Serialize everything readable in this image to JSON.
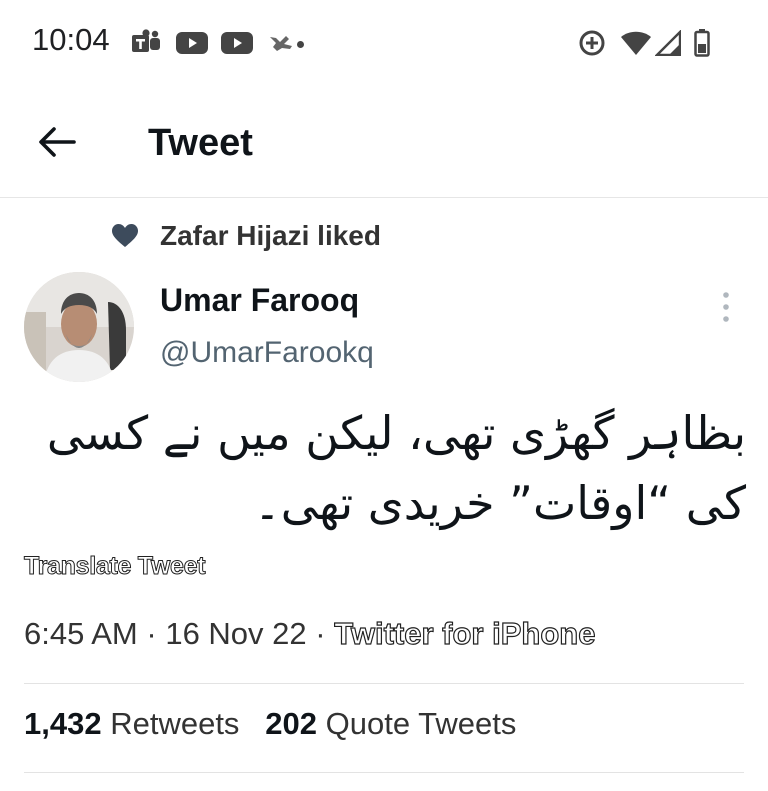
{
  "status_bar": {
    "time": "10:04",
    "icons": [
      "teams-icon",
      "youtube-icon",
      "youtube-icon",
      "notification-icon",
      "dot-icon",
      "sync-icon",
      "wifi-icon",
      "signal-icon",
      "battery-icon"
    ]
  },
  "header": {
    "back_icon": "arrow-left-icon",
    "title": "Tweet"
  },
  "social_context": {
    "icon": "heart-icon",
    "text": "Zafar Hijazi liked"
  },
  "author": {
    "name": "Umar Farooq",
    "handle": "@UmarFarookq"
  },
  "tweet": {
    "text": "بظاہر گھڑی تھی، لیکن میں نے کسی کی “اوقات” خریدی تھی۔",
    "translate_label": "Translate Tweet",
    "time": "6:45 AM",
    "separator": "·",
    "date": "16 Nov 22",
    "source": "Twitter for iPhone"
  },
  "stats": {
    "retweets_count": "1,432",
    "retweets_label": "Retweets",
    "quotes_count": "202",
    "quotes_label": "Quote Tweets"
  },
  "colors": {
    "text": "#0f1419",
    "secondary": "#536471",
    "divider": "#e6e6e6",
    "heart": "#3d4b5c"
  }
}
